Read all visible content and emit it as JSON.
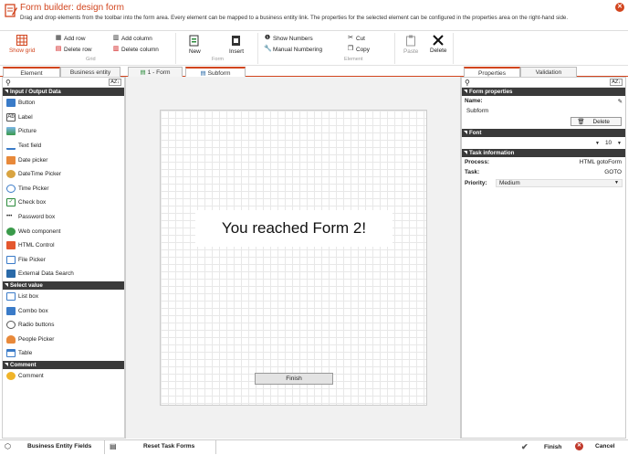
{
  "window": {
    "title": "Form builder: design form",
    "subtitle": "Drag and drop elements from the toolbar into the form area. Every element can be mapped to a business entity link. The properties for the selected element can be configured in the properties area on the right-hand side."
  },
  "ribbon": {
    "show_grid": "Show grid",
    "add_row": "Add row",
    "delete_row": "Delete row",
    "add_column": "Add column",
    "delete_column": "Delete column",
    "grid_group": "Grid",
    "new": "New",
    "insert": "Insert",
    "form_group": "Form",
    "show_numbers": "Show Numbers",
    "manual_numbering": "Manual Numbering",
    "cut": "Cut",
    "copy": "Copy",
    "element_group": "Element",
    "paste": "Paste",
    "delete": "Delete"
  },
  "left_tabs": [
    "Element",
    "Business entity"
  ],
  "form_tabs": [
    "1 - Form",
    "Subform"
  ],
  "right_tabs": [
    "Properties",
    "Validation"
  ],
  "toolbox": {
    "sections": [
      {
        "title": "Input / Output Data",
        "items": [
          "Button",
          "Label",
          "Picture",
          "Text field",
          "Date picker",
          "DateTime Picker",
          "Time Picker",
          "Check box",
          "Password box",
          "Web component",
          "HTML Control",
          "File Picker",
          "External Data Search"
        ]
      },
      {
        "title": "Select value",
        "items": [
          "List box",
          "Combo box",
          "Radio buttons",
          "People Picker",
          "Table"
        ]
      },
      {
        "title": "Comment",
        "items": [
          "Comment"
        ]
      }
    ]
  },
  "form": {
    "message": "You reached Form 2!",
    "finish_button": "Finish"
  },
  "properties": {
    "form_properties_title": "Form properties",
    "name_label": "Name:",
    "name_value": "Subform",
    "delete": "Delete",
    "font_title": "Font",
    "font_size": "10",
    "task_title": "Task information",
    "process_label": "Process:",
    "process_value": "HTML gotoForm",
    "task_label": "Task:",
    "task_value": "GOTO",
    "priority_label": "Priority:",
    "priority_value": "Medium"
  },
  "bottom": {
    "business_entity_fields": "Business Entity Fields",
    "reset_task_forms": "Reset Task Forms",
    "finish": "Finish",
    "cancel": "Cancel"
  },
  "colors": {
    "accent": "#d2451e",
    "dark_header": "#3a3a3a"
  }
}
